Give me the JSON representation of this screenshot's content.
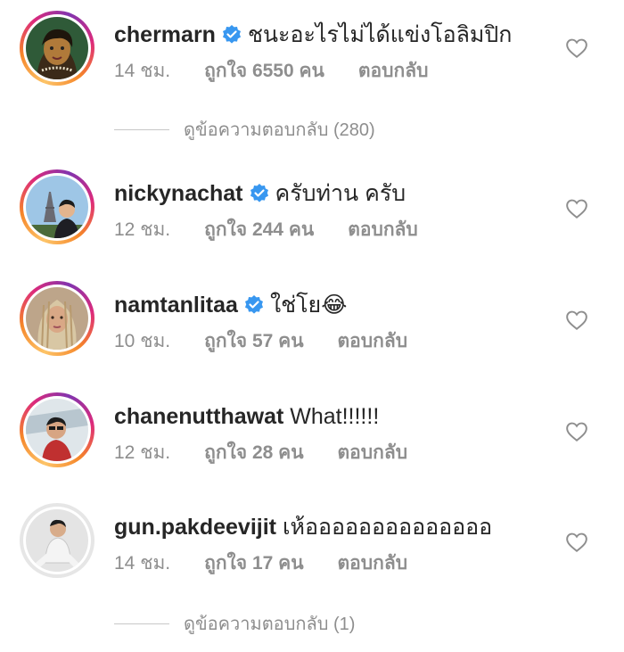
{
  "comments": [
    {
      "username": "chermarn",
      "verified": true,
      "text": "ชนะอะไรไม่ได้แข่งโอลิมปิก",
      "time": "14 ชม.",
      "likes": "ถูกใจ 6550 คน",
      "reply": "ตอบกลับ",
      "avatar": "cartoon-woman-avatar"
    },
    {
      "username": "nickynachat",
      "verified": true,
      "text": "ครับท่าน ครับ",
      "time": "12 ชม.",
      "likes": "ถูกใจ 244 คน",
      "reply": "ตอบกลับ",
      "avatar": "eiffel-tower-man-avatar"
    },
    {
      "username": "namtanlitaa",
      "verified": true,
      "text": "ใช่โย😂",
      "time": "10 ชม.",
      "likes": "ถูกใจ 57 คน",
      "reply": "ตอบกลับ",
      "avatar": "braided-hair-woman-avatar"
    },
    {
      "username": "chanenutthawat",
      "verified": false,
      "text": "What!!!!!!",
      "time": "12 ชม.",
      "likes": "ถูกใจ 28 คน",
      "reply": "ตอบกลับ",
      "avatar": "man-in-car-avatar"
    },
    {
      "username": "gun.pakdeevijit",
      "verified": false,
      "text": "เห้ออออออออออออออ",
      "time": "14 ชม.",
      "likes": "ถูกใจ 17 คน",
      "reply": "ตอบกลับ",
      "avatar": "man-white-suit-avatar"
    }
  ],
  "view_replies": [
    {
      "label": "ดูข้อความตอบกลับ (280)"
    },
    {
      "label": "ดูข้อความตอบกลับ (1)"
    }
  ],
  "colors": {
    "verified": "#3897f0",
    "secondary_text": "#8e8e8e",
    "primary_text": "#262626"
  },
  "icons": {
    "verified": "verified-badge-icon",
    "like": "heart-outline-icon"
  }
}
